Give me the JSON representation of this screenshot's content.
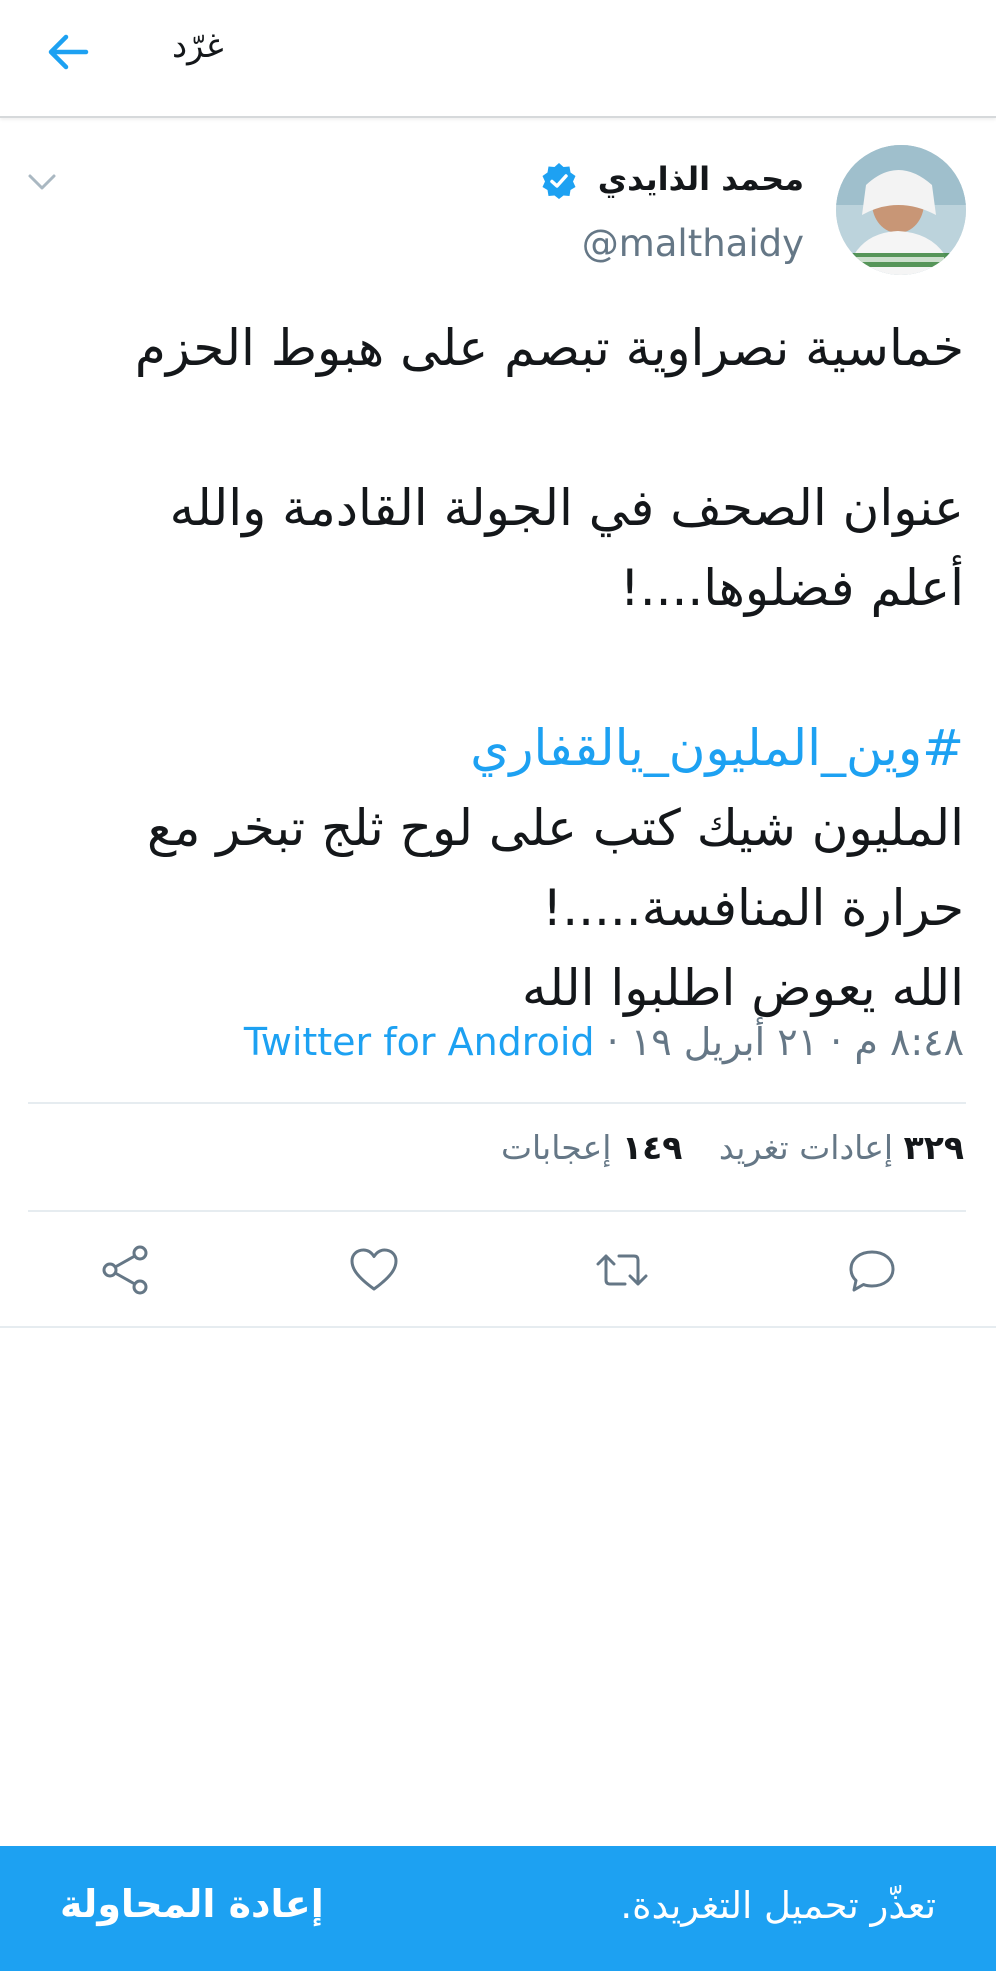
{
  "header": {
    "title": "غرّد",
    "back_icon": "arrow-left-icon"
  },
  "tweet": {
    "author_name": "محمد الذايدي",
    "author_handle": "@malthaidy",
    "verified": true,
    "lines": {
      "l1": "خماسية نصراوية تبصم على هبوط الحزم",
      "l2": "عنوان الصحف في الجولة القادمة والله",
      "l3": "أعلم فضلوها....!",
      "hashtag": "#وين_المليون_يالقفاري",
      "l4": "المليون شيك كتب على لوح ثلج تبخر مع",
      "l5": "حرارة المنافسة.....!",
      "l6": "الله يعوض اطلبوا الله"
    },
    "time": "٨:٤٨ م",
    "date": "٢١ أبريل ١٩",
    "separator": "·",
    "source": "Twitter for Android"
  },
  "stats": {
    "retweets_count": "٣٢٩",
    "retweets_label": "إعادات تغريد",
    "likes_count": "١٤٩",
    "likes_label": "إعجابات"
  },
  "actions": {
    "reply_icon": "reply-icon",
    "retweet_icon": "retweet-icon",
    "like_icon": "heart-icon",
    "share_icon": "share-icon"
  },
  "snackbar": {
    "message": "تعذّر تحميل التغريدة.",
    "retry_label": "إعادة المحاولة"
  },
  "colors": {
    "accent": "#1da1f2",
    "secondary_text": "#657786",
    "divider": "#e6ecf0"
  }
}
